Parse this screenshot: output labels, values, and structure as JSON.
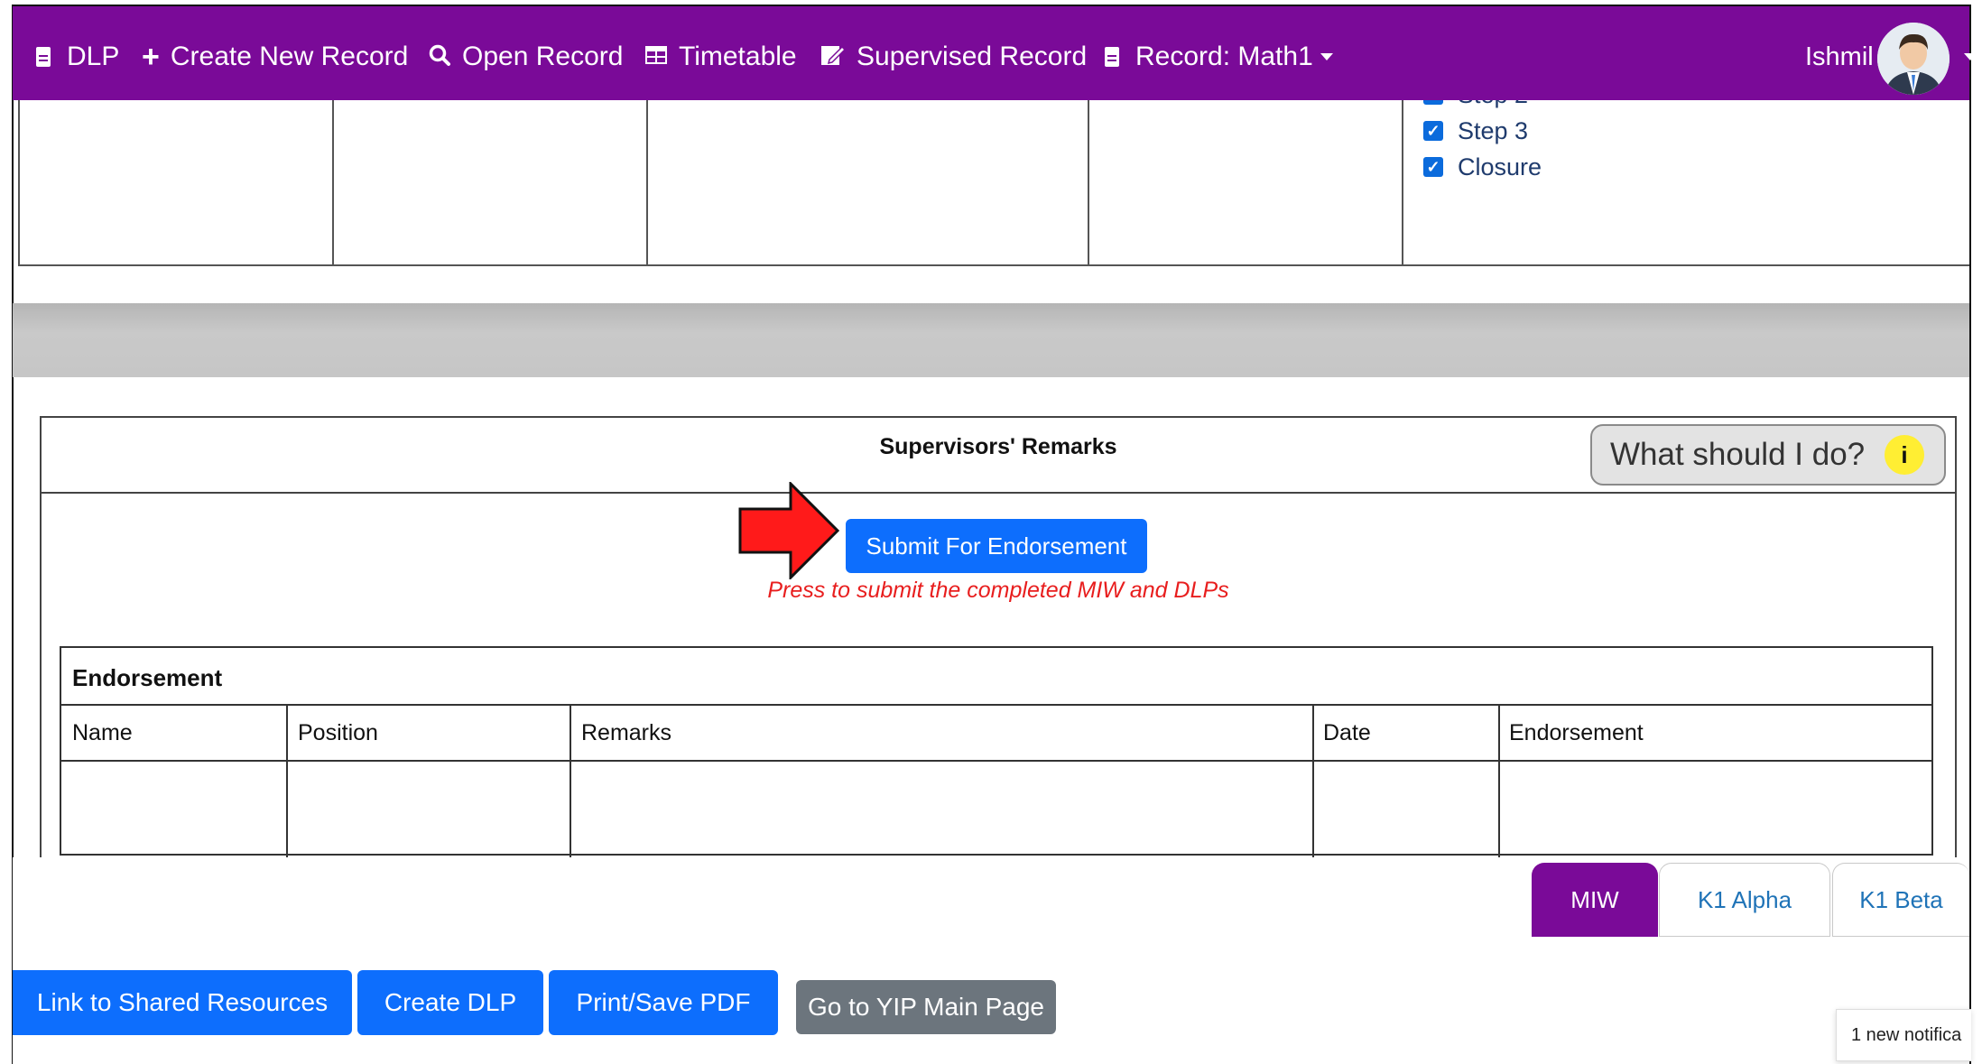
{
  "navbar": {
    "brand": "DLP",
    "create_new_record": "Create New Record",
    "open_record": "Open Record",
    "timetable": "Timetable",
    "supervised_record": "Supervised Record",
    "record_label": "Record: Math1",
    "user_name": "Ishmil",
    "bg_color": "#7a0a98"
  },
  "checklist": [
    {
      "label": "Step 2",
      "checked": true
    },
    {
      "label": "Step 3",
      "checked": true
    },
    {
      "label": "Closure",
      "checked": true
    }
  ],
  "remarks": {
    "title": "Supervisors' Remarks",
    "help_button": "What should I do?",
    "help_icon": "i",
    "submit_button": "Submit For Endorsement",
    "submit_hint": "Press to submit the completed MIW and DLPs"
  },
  "endorsement": {
    "title": "Endorsement",
    "columns": [
      "Name",
      "Position",
      "Remarks",
      "Date",
      "Endorsement"
    ]
  },
  "tabs": {
    "active": "MIW",
    "k1_alpha": "K1 Alpha",
    "k1_beta": "K1 Beta"
  },
  "footer_buttons": {
    "shared_resources": "Link to Shared Resources",
    "create_dlp": "Create DLP",
    "print_pdf": "Print/Save PDF",
    "main_page": "Go to YIP Main Page"
  },
  "notification": "1 new notifica",
  "colors": {
    "primary": "#0d6efd",
    "secondary": "#6c757d",
    "hint": "#e81e1e",
    "help_dot": "#ffee33"
  }
}
